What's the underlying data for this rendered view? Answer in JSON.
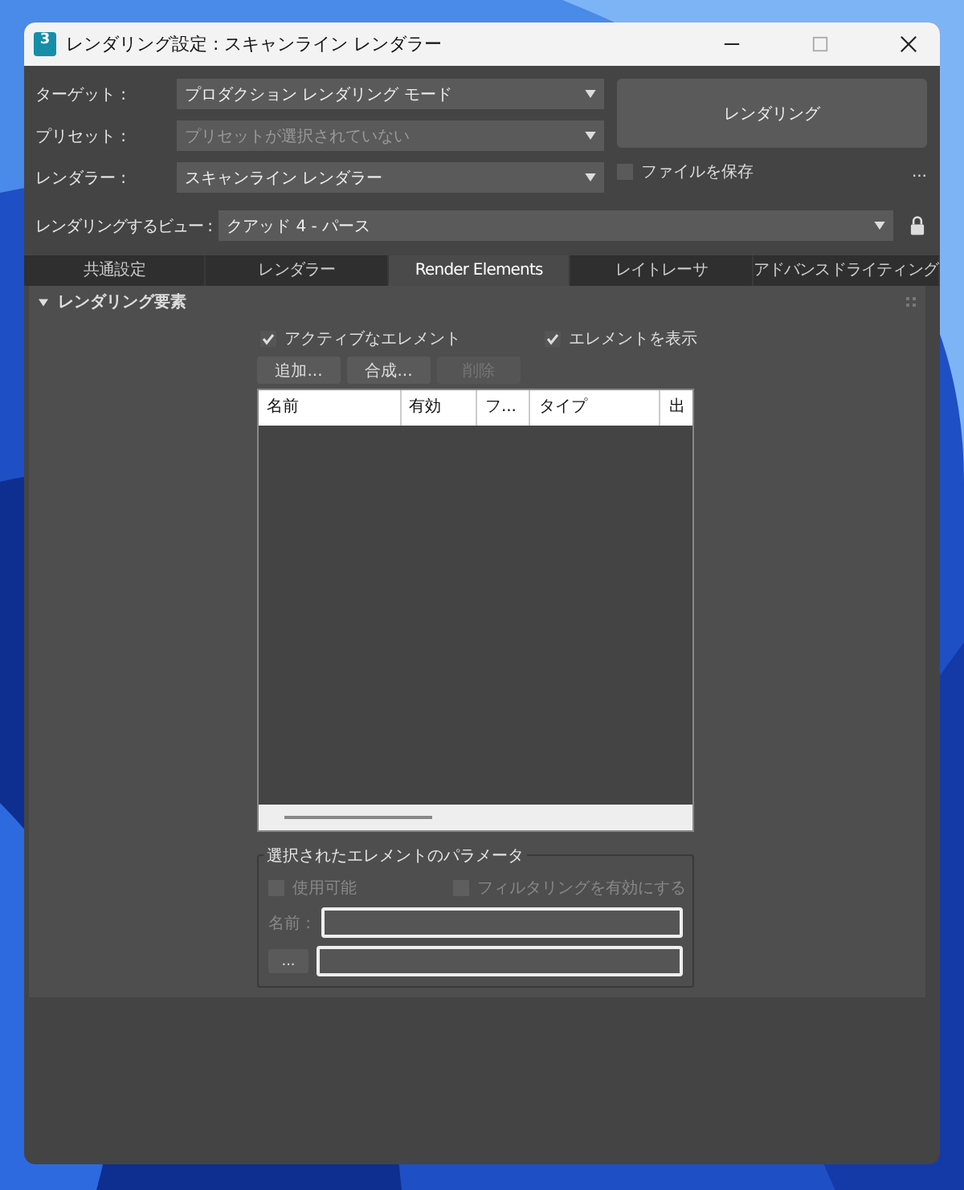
{
  "window": {
    "title": "レンダリング設定 : スキャンライン レンダラー",
    "app_icon_text": "3"
  },
  "settings": [
    {
      "label": "ターゲット :",
      "value": "プロダクション レンダリング モード",
      "disabled": false
    },
    {
      "label": "プリセット :",
      "value": "プリセットが選択されていない",
      "disabled": true
    },
    {
      "label": "レンダラー :",
      "value": "スキャンライン レンダラー",
      "disabled": false
    }
  ],
  "render_button": "レンダリング",
  "save_file": {
    "label": "ファイルを保存",
    "checked": false
  },
  "more_button": "...",
  "view": {
    "label": "レンダリングするビュー :",
    "value": "クアッド 4 - パース"
  },
  "tabs": [
    {
      "label": "共通設定",
      "selected": false
    },
    {
      "label": "レンダラー",
      "selected": false
    },
    {
      "label": "Render Elements",
      "selected": true
    },
    {
      "label": "レイトレーサ",
      "selected": false
    },
    {
      "label": "アドバンスドライティング",
      "selected": false
    }
  ],
  "rollout": {
    "title": "レンダリング要素",
    "expanded": true
  },
  "toggles": [
    {
      "label": "アクティブなエレメント",
      "checked": true
    },
    {
      "label": "エレメントを表示",
      "checked": true
    }
  ],
  "buttons": [
    {
      "label": "追加...",
      "disabled": false
    },
    {
      "label": "合成...",
      "disabled": false
    },
    {
      "label": "削除",
      "disabled": true
    }
  ],
  "table": {
    "columns": [
      "名前",
      "有効",
      "フ...",
      "タイプ",
      "出"
    ]
  },
  "parameters": {
    "title": "選択されたエレメントのパラメータ",
    "options": [
      {
        "label": "使用可能",
        "checked": false,
        "disabled": true
      },
      {
        "label": "フィルタリングを有効にする",
        "checked": false,
        "disabled": true
      }
    ],
    "name_label": "名前 :",
    "browse_button": "..."
  }
}
